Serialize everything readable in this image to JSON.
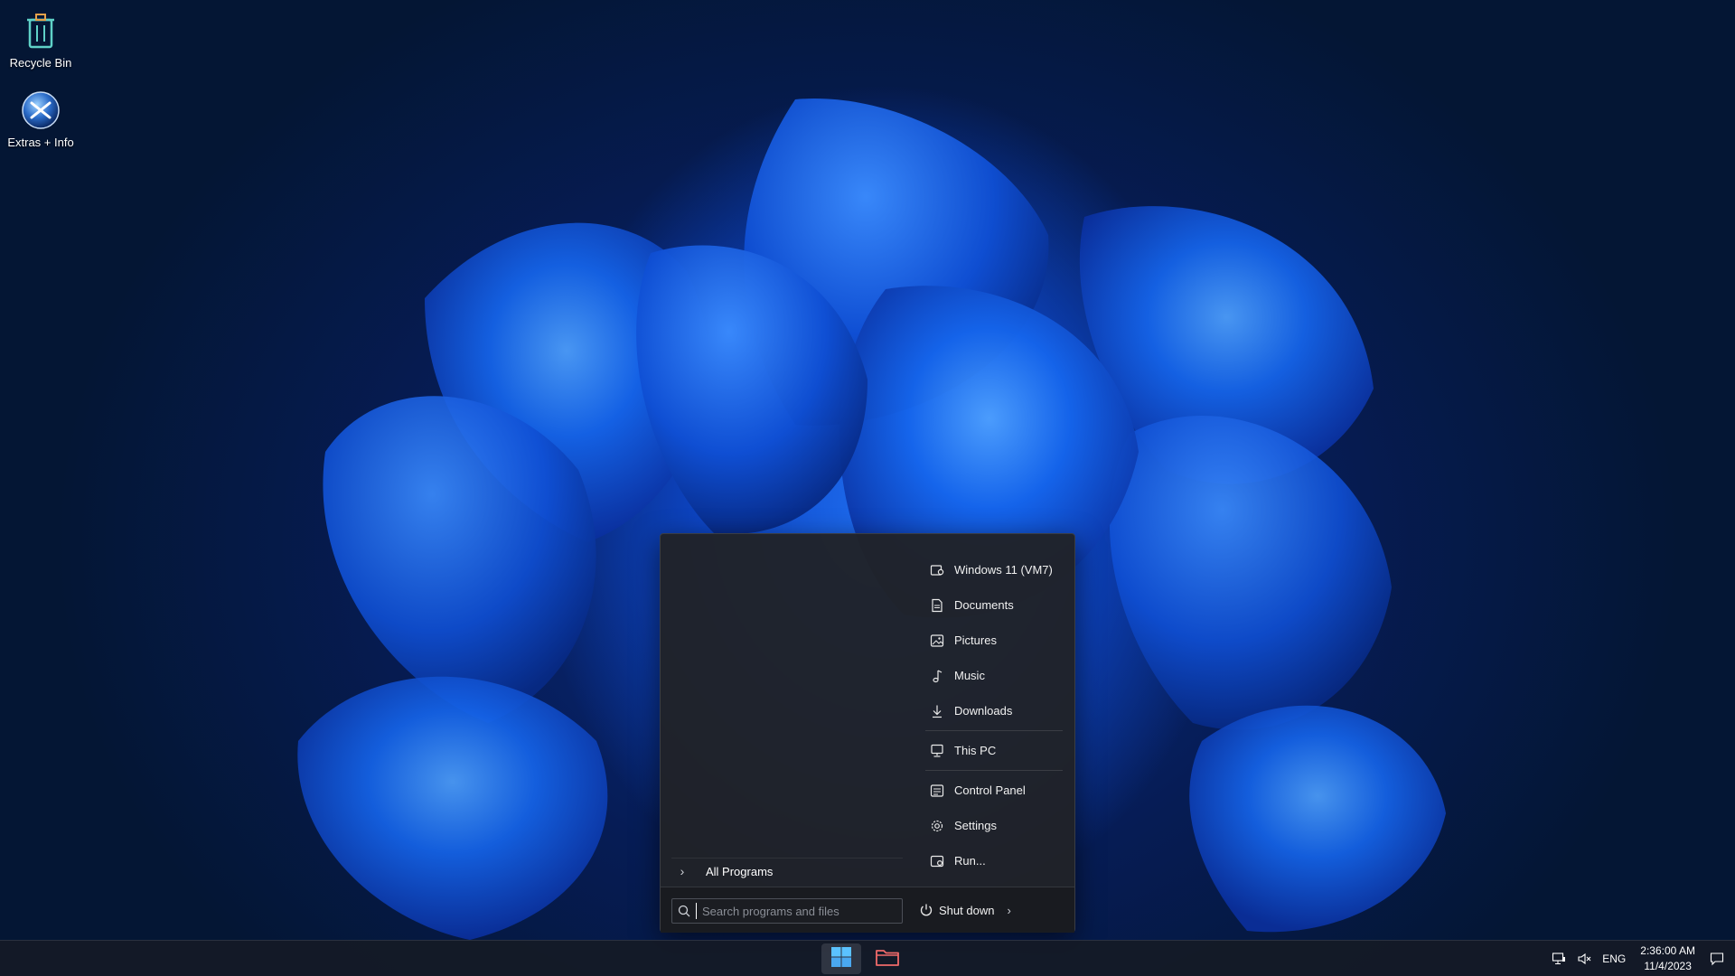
{
  "desktop": {
    "icons": [
      {
        "label": "Recycle Bin",
        "icon": "recycle-bin-icon"
      },
      {
        "label": "Extras + Info",
        "icon": "extras-info-icon"
      }
    ]
  },
  "start_menu": {
    "places": [
      {
        "label": "Windows 11 (VM7)",
        "icon": "user-folder-icon"
      },
      {
        "label": "Documents",
        "icon": "document-icon"
      },
      {
        "label": "Pictures",
        "icon": "picture-icon"
      },
      {
        "label": "Music",
        "icon": "music-note-icon"
      },
      {
        "label": "Downloads",
        "icon": "download-arrow-icon"
      },
      {
        "label": "This PC",
        "icon": "computer-icon"
      },
      {
        "label": "Control Panel",
        "icon": "control-panel-icon"
      },
      {
        "label": "Settings",
        "icon": "gear-icon"
      },
      {
        "label": "Run...",
        "icon": "run-icon"
      }
    ],
    "all_programs_label": "All Programs",
    "search_placeholder": "Search programs and files",
    "shutdown_label": "Shut down"
  },
  "taskbar": {
    "pinned": [
      {
        "name": "start",
        "icon": "windows-logo-icon"
      },
      {
        "name": "file-explorer",
        "icon": "folder-icon"
      }
    ],
    "tray": {
      "language": "ENG",
      "time": "2:36:00 AM",
      "date": "11/4/2023"
    }
  },
  "colors": {
    "accent": "#0f5bd6",
    "menu_bg": "#202228",
    "taskbar_bg": "#141a26"
  }
}
